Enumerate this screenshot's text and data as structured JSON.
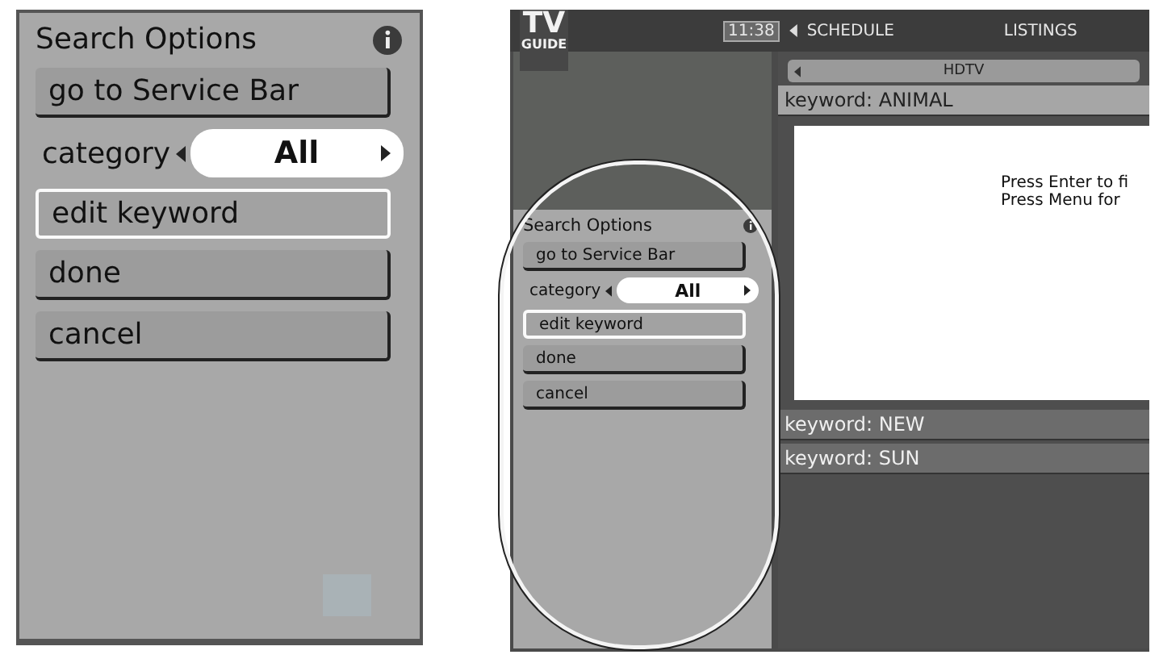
{
  "zoomed_panel": {
    "title": "Search Options",
    "items": [
      {
        "kind": "button",
        "label": "go to Service Bar",
        "selected": false
      },
      {
        "kind": "selector",
        "label": "category",
        "value": "All",
        "selected": false
      },
      {
        "kind": "button",
        "label": "edit keyword",
        "selected": true
      },
      {
        "kind": "button",
        "label": "done",
        "selected": false
      },
      {
        "kind": "button",
        "label": "cancel",
        "selected": false
      }
    ]
  },
  "tv_screen": {
    "logo_top": "TV",
    "logo_bottom": "GUIDE",
    "time": "11:38",
    "nav": [
      {
        "label": "SCHEDULE"
      },
      {
        "label": "LISTINGS"
      }
    ],
    "channel_tab": "HDTV",
    "search_panel": {
      "title": "Search Options",
      "items": [
        {
          "kind": "button",
          "label": "go to Service Bar",
          "selected": false
        },
        {
          "kind": "selector",
          "label": "category",
          "value": "All",
          "selected": false
        },
        {
          "kind": "button",
          "label": "edit keyword",
          "selected": true
        },
        {
          "kind": "button",
          "label": "done",
          "selected": false
        },
        {
          "kind": "button",
          "label": "cancel",
          "selected": false
        }
      ]
    },
    "results": [
      {
        "label": "keyword: ANIMAL",
        "expanded": true,
        "message": [
          "Press Enter to fi",
          "Press Menu for"
        ]
      },
      {
        "label": "keyword: NEW",
        "expanded": false
      },
      {
        "label": "keyword: SUN",
        "expanded": false
      }
    ]
  }
}
